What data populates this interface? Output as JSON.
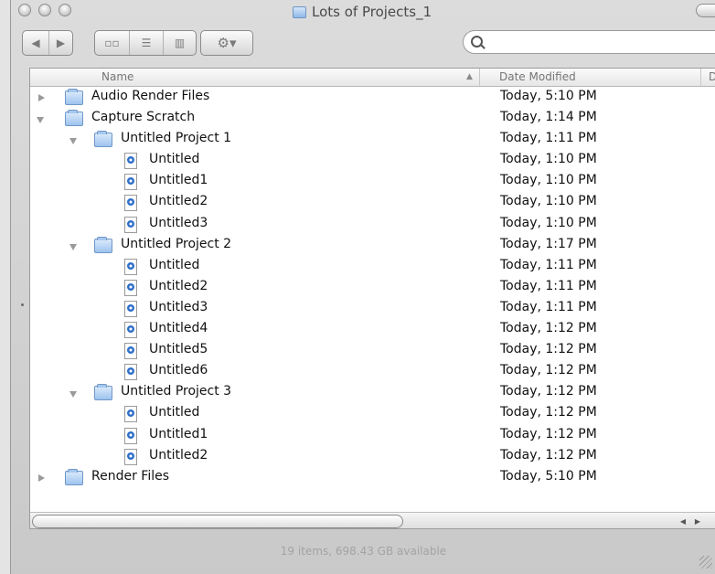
{
  "window": {
    "title": "Lots of Projects_1",
    "status": "19 items, 698.43 GB available"
  },
  "toolbar": {
    "back_icon": "back-arrow-icon",
    "forward_icon": "forward-arrow-icon",
    "views": [
      "icon-view-icon",
      "list-view-icon",
      "column-view-icon"
    ],
    "action_icon": "gear-icon"
  },
  "search": {
    "value": "",
    "placeholder": ""
  },
  "columns": {
    "name": "Name",
    "date_modified": "Date Modified",
    "next_partial": "D"
  },
  "files": [
    {
      "name": "Audio Render Files",
      "date": "Today, 5:10 PM",
      "kind": "folder",
      "level": 0,
      "disclosure": "closed"
    },
    {
      "name": "Capture Scratch",
      "date": "Today, 1:14 PM",
      "kind": "folder",
      "level": 0,
      "disclosure": "open"
    },
    {
      "name": "Untitled Project 1",
      "date": "Today, 1:11 PM",
      "kind": "folder",
      "level": 1,
      "disclosure": "open"
    },
    {
      "name": "Untitled",
      "date": "Today, 1:10 PM",
      "kind": "doc",
      "level": 2,
      "disclosure": ""
    },
    {
      "name": "Untitled1",
      "date": "Today, 1:10 PM",
      "kind": "doc",
      "level": 2,
      "disclosure": ""
    },
    {
      "name": "Untitled2",
      "date": "Today, 1:10 PM",
      "kind": "doc",
      "level": 2,
      "disclosure": ""
    },
    {
      "name": "Untitled3",
      "date": "Today, 1:10 PM",
      "kind": "doc",
      "level": 2,
      "disclosure": ""
    },
    {
      "name": "Untitled Project 2",
      "date": "Today, 1:17 PM",
      "kind": "folder",
      "level": 1,
      "disclosure": "open"
    },
    {
      "name": "Untitled",
      "date": "Today, 1:11 PM",
      "kind": "doc",
      "level": 2,
      "disclosure": ""
    },
    {
      "name": "Untitled2",
      "date": "Today, 1:11 PM",
      "kind": "doc",
      "level": 2,
      "disclosure": ""
    },
    {
      "name": "Untitled3",
      "date": "Today, 1:11 PM",
      "kind": "doc",
      "level": 2,
      "disclosure": ""
    },
    {
      "name": "Untitled4",
      "date": "Today, 1:12 PM",
      "kind": "doc",
      "level": 2,
      "disclosure": ""
    },
    {
      "name": "Untitled5",
      "date": "Today, 1:12 PM",
      "kind": "doc",
      "level": 2,
      "disclosure": ""
    },
    {
      "name": "Untitled6",
      "date": "Today, 1:12 PM",
      "kind": "doc",
      "level": 2,
      "disclosure": ""
    },
    {
      "name": "Untitled Project 3",
      "date": "Today, 1:12 PM",
      "kind": "folder",
      "level": 1,
      "disclosure": "open"
    },
    {
      "name": "Untitled",
      "date": "Today, 1:12 PM",
      "kind": "doc",
      "level": 2,
      "disclosure": ""
    },
    {
      "name": "Untitled1",
      "date": "Today, 1:12 PM",
      "kind": "doc",
      "level": 2,
      "disclosure": ""
    },
    {
      "name": "Untitled2",
      "date": "Today, 1:12 PM",
      "kind": "doc",
      "level": 2,
      "disclosure": ""
    },
    {
      "name": "Render Files",
      "date": "Today, 5:10 PM",
      "kind": "folder",
      "level": 0,
      "disclosure": "closed"
    }
  ]
}
